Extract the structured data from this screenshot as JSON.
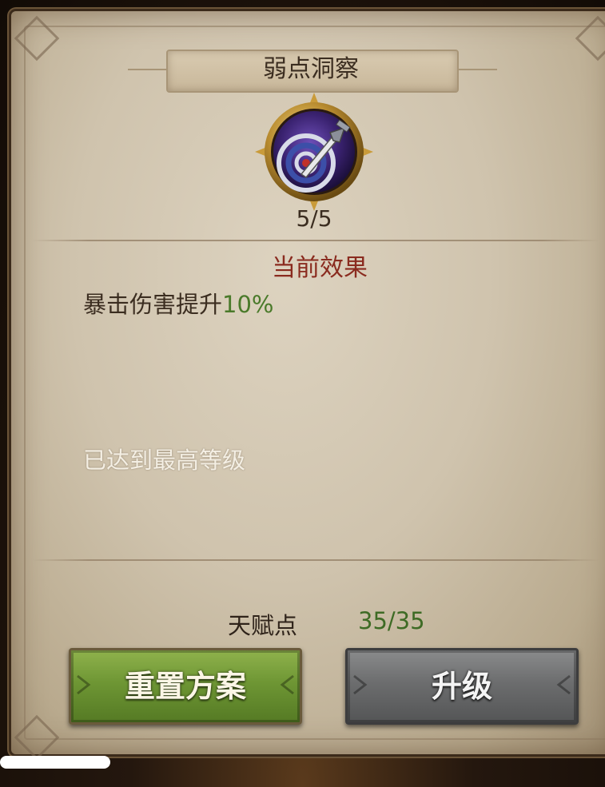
{
  "panel": {
    "title": "弱点洞察"
  },
  "skill": {
    "icon": "target-dagger-icon",
    "level": "5/5"
  },
  "effect": {
    "header": "当前效果",
    "description": "暴击伤害提升",
    "value": "10%",
    "max_level_note": "已达到最高等级"
  },
  "talent": {
    "label": "天赋点",
    "value": "35/35"
  },
  "buttons": {
    "reset_label": "重置方案",
    "upgrade_label": "升级"
  },
  "colors": {
    "header_red": "#8a2b1f",
    "value_green": "#4a7a2a",
    "reset_button": "#6e9634",
    "upgrade_button": "#6c6d6e"
  }
}
